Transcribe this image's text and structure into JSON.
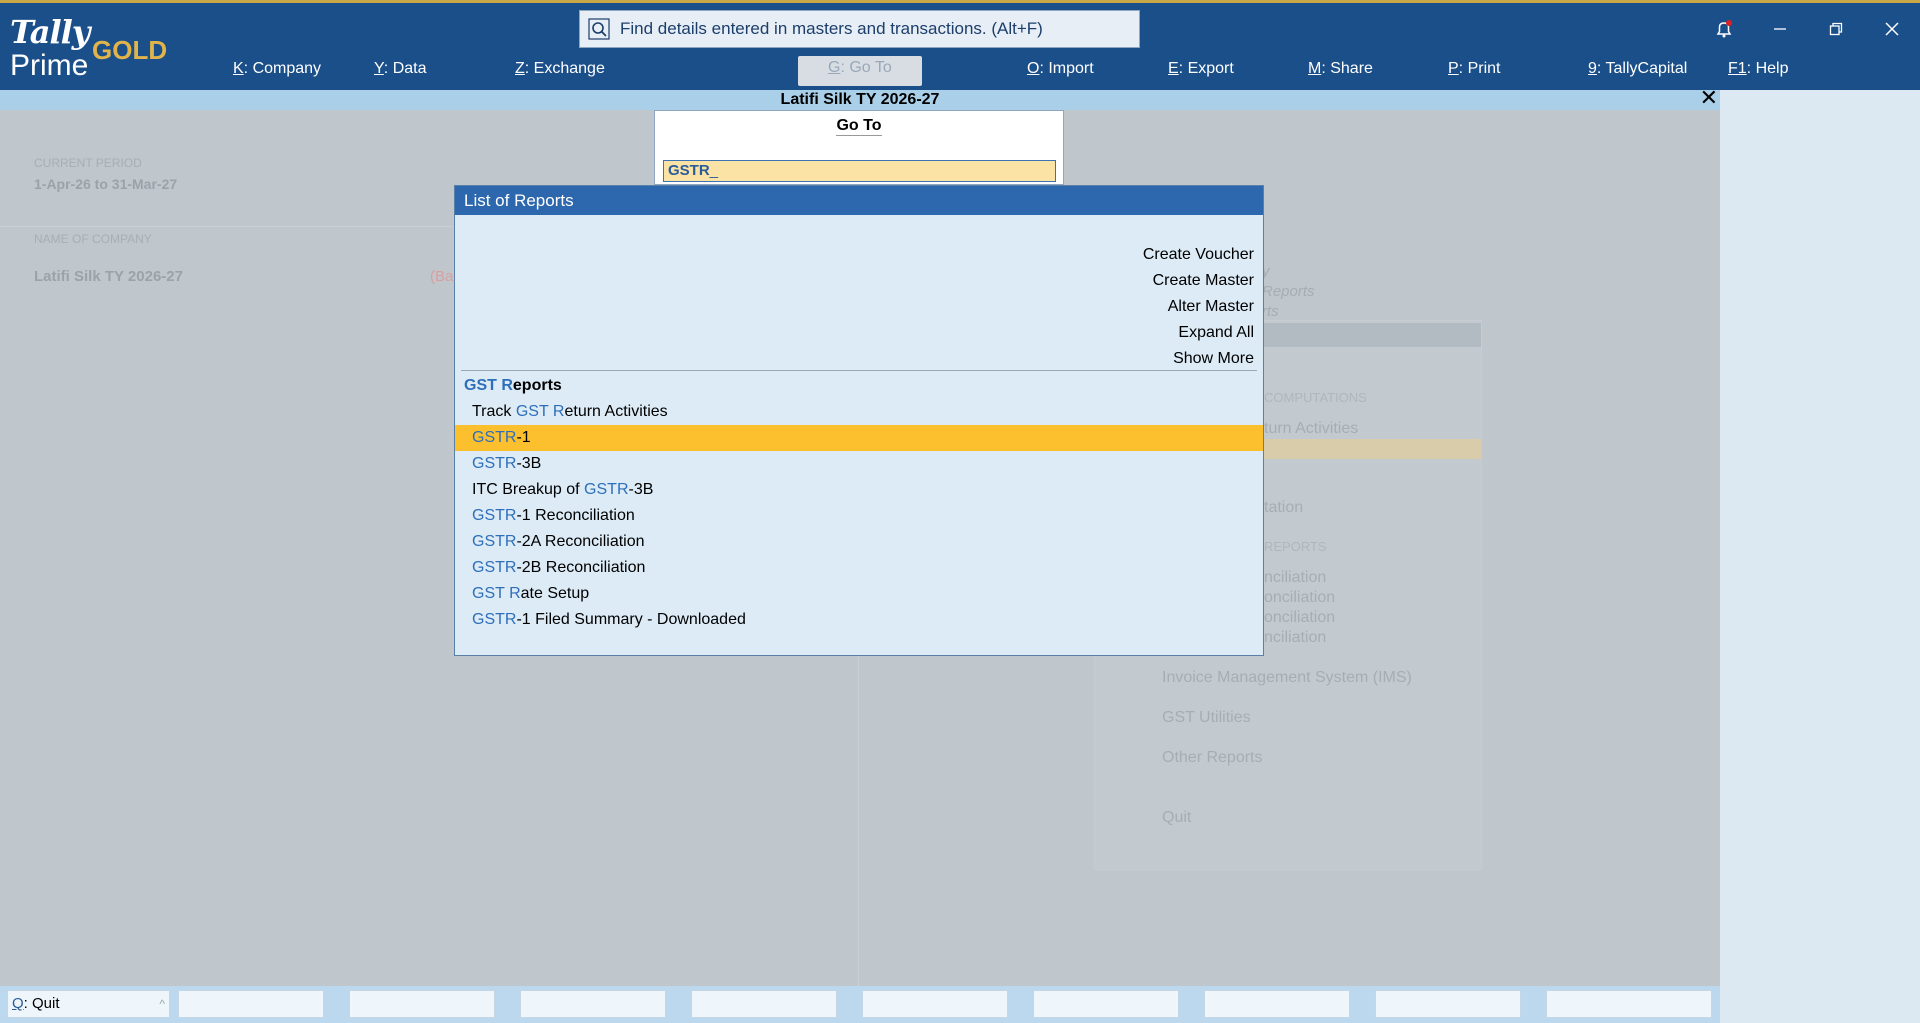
{
  "app": {
    "logo_top": "Tally",
    "logo_bottom": "Prime",
    "edition": "GOLD",
    "search_placeholder": "Find details entered in masters and transactions. (Alt+F)"
  },
  "menu": [
    {
      "key": "K",
      "label": "Company"
    },
    {
      "key": "Y",
      "label": "Data"
    },
    {
      "key": "Z",
      "label": "Exchange"
    },
    {
      "key": "G",
      "label": "Go To"
    },
    {
      "key": "O",
      "label": "Import"
    },
    {
      "key": "E",
      "label": "Export"
    },
    {
      "key": "M",
      "label": "Share"
    },
    {
      "key": "P",
      "label": "Print"
    },
    {
      "key": "9",
      "label": "TallyCapital"
    },
    {
      "key": "F1",
      "label": "Help"
    }
  ],
  "company_bar": {
    "title": "Latifi Silk TY 2026-27",
    "close": "✕"
  },
  "background": {
    "current_period_label": "CURRENT PERIOD",
    "current_period_value": "1-Apr-26 to 31-Mar-27",
    "company_label": "NAME OF COMPANY",
    "company_name": "Latifi Silk TY 2026-27",
    "company_tag": "(Ba",
    "menu_items": {
      "m1": "y",
      "m2": "Reports",
      "m3": "rts",
      "section1": "COMPUTATIONS",
      "m4": "turn Activities",
      "m5": "tation",
      "section2": "REPORTS",
      "m6": "nciliation",
      "m7": "onciliation",
      "m8": "onciliation",
      "m9": "nciliation",
      "ims": "Invoice Management System (IMS)",
      "utilities": "GST Utilities",
      "other": "Other Reports",
      "quit": "Quit"
    }
  },
  "goto": {
    "title": "Go To",
    "input_value": "GSTR"
  },
  "list": {
    "title": "List of Reports",
    "actions": [
      "Create Voucher",
      "Create Master",
      "Alter Master",
      "Expand All",
      "Show More"
    ],
    "group": {
      "hl1": "GST",
      "hl2": "R",
      "rest": "eports"
    },
    "items": [
      {
        "pre": "Track ",
        "hl1": "GST",
        "mid": " ",
        "hl2": "R",
        "post": "eturn Activities"
      },
      {
        "pre": "",
        "hl1": "GSTR",
        "mid": "",
        "hl2": "",
        "post": "-1"
      },
      {
        "pre": "",
        "hl1": "GSTR",
        "mid": "",
        "hl2": "",
        "post": "-3B"
      },
      {
        "pre": "ITC Breakup of ",
        "hl1": "GSTR",
        "mid": "",
        "hl2": "",
        "post": "-3B"
      },
      {
        "pre": "",
        "hl1": "GSTR",
        "mid": "",
        "hl2": "",
        "post": "-1 Reconciliation"
      },
      {
        "pre": "",
        "hl1": "GSTR",
        "mid": "",
        "hl2": "",
        "post": "-2A Reconciliation"
      },
      {
        "pre": "",
        "hl1": "GSTR",
        "mid": "",
        "hl2": "",
        "post": "-2B Reconciliation"
      },
      {
        "pre": "",
        "hl1": "GST",
        "mid": " ",
        "hl2": "R",
        "post": "ate Setup"
      },
      {
        "pre": "",
        "hl1": "GSTR",
        "mid": "",
        "hl2": "",
        "post": "-1 Filed Summary - Downloaded"
      }
    ]
  },
  "bottom": {
    "quit_key": "Q",
    "quit_label": "Quit",
    "quit_arrow": "^"
  }
}
